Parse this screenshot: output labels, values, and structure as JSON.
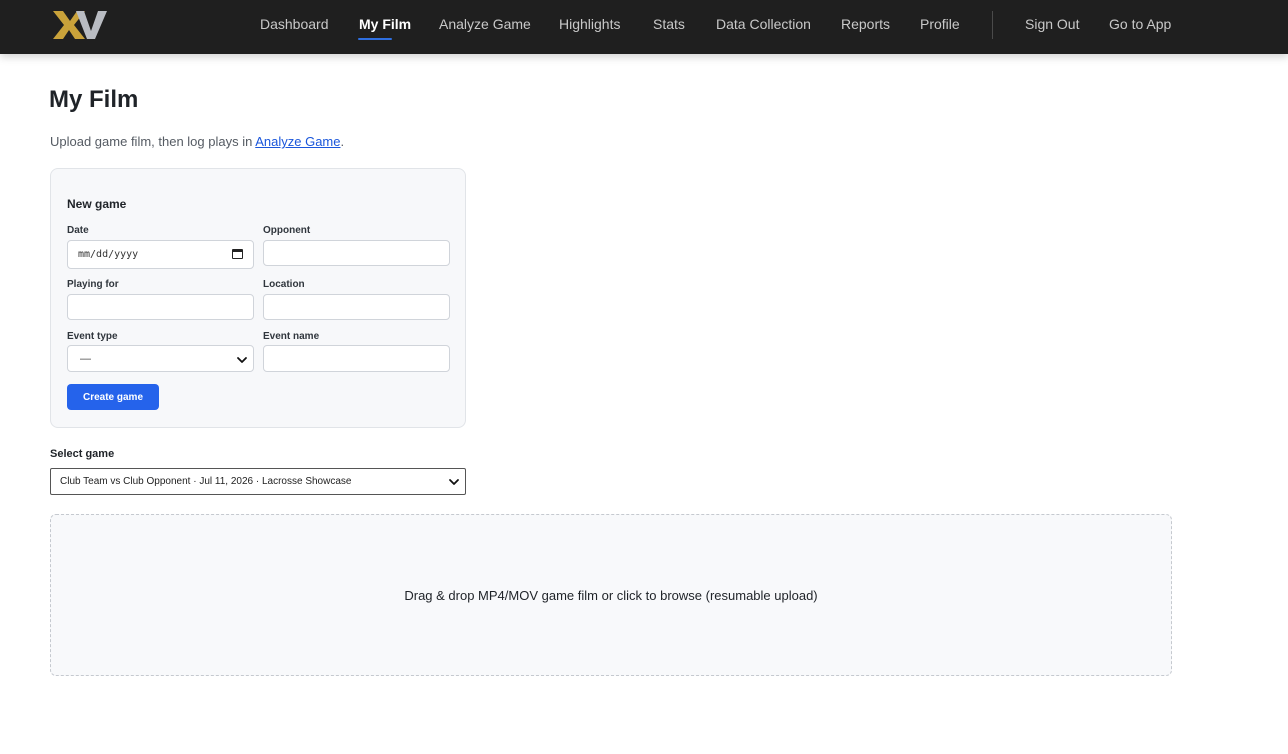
{
  "nav": {
    "logo_text": "XV",
    "items": [
      {
        "label": "Dashboard"
      },
      {
        "label": "My Film",
        "active": true
      },
      {
        "label": "Analyze Game"
      },
      {
        "label": "Highlights"
      },
      {
        "label": "Stats"
      },
      {
        "label": "Data Collection"
      },
      {
        "label": "Reports"
      },
      {
        "label": "Profile"
      }
    ],
    "sign_out": "Sign Out",
    "go_to_app": "Go to App"
  },
  "page": {
    "title": "My Film",
    "subtitle_prefix": "Upload game film, then log plays in ",
    "subtitle_link": "Analyze Game",
    "subtitle_suffix": "."
  },
  "new_game": {
    "title": "New game",
    "date_label": "Date",
    "date_placeholder": "mm/dd/yyyy",
    "opponent_label": "Opponent",
    "opponent_value": "",
    "playing_for_label": "Playing for",
    "playing_for_value": "",
    "location_label": "Location",
    "location_value": "",
    "event_type_label": "Event type",
    "event_type_value": "—",
    "event_name_label": "Event name",
    "event_name_value": "",
    "create_button": "Create game"
  },
  "select_game": {
    "label": "Select game",
    "value": "Club Team vs Club Opponent · Jul 11, 2026 · Lacrosse Showcase"
  },
  "dropzone": {
    "text": "Drag & drop MP4/MOV game film or click to browse (resumable upload)"
  },
  "colors": {
    "nav_bg": "#1f1f1f",
    "accent": "#2563eb",
    "logo_gold": "#c9a23a",
    "logo_silver": "#b9bcc2",
    "link": "#1a56db"
  }
}
